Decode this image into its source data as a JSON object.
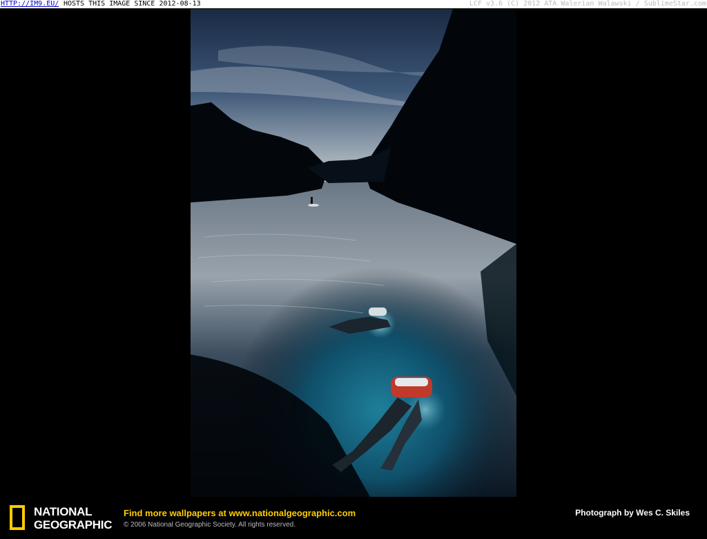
{
  "topbar": {
    "link": "HTTP://IM9.EU/",
    "hosts_text": "HOSTS THIS IMAGE SINCE 2012-08-13",
    "credit": "LCF v3.6 (C) 2012 ATA Walerian Walawski / SublimeStar.com"
  },
  "photo": {
    "description_icon": "photo-river-divers"
  },
  "footer": {
    "logo_line1": "NATIONAL",
    "logo_line2": "GEOGRAPHIC",
    "find_prefix": "Find more wallpapers at ",
    "find_url": "www.nationalgeographic.com",
    "copyright": "© 2006 National Geographic Society. All rights reserved.",
    "photographer": "Photograph by Wes C. Skiles"
  },
  "colors": {
    "brand_yellow": "#ffcc00",
    "background": "#000000"
  }
}
